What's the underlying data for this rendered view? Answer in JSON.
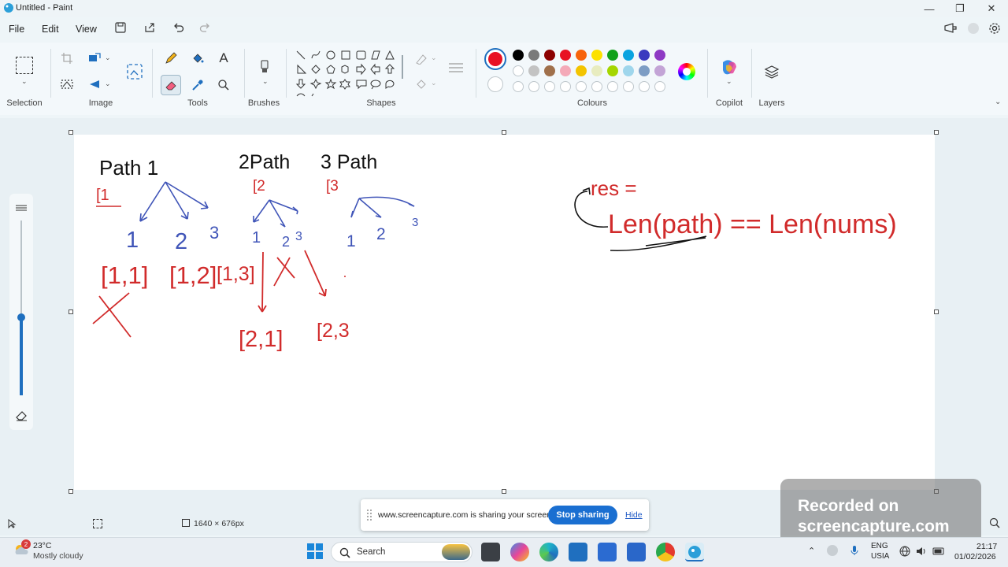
{
  "window": {
    "title": "Untitled - Paint",
    "minimize": "—",
    "restore": "❐",
    "close": "✕"
  },
  "menu": {
    "file": "File",
    "edit": "Edit",
    "view": "View"
  },
  "ribbon": {
    "groups": {
      "selection": "Selection",
      "image": "Image",
      "tools": "Tools",
      "brushes": "Brushes",
      "shapes": "Shapes",
      "colours": "Colours",
      "copilot": "Copilot",
      "layers": "Layers"
    },
    "tools": {
      "text_tool": "A"
    },
    "colours": {
      "primary": "#e81123",
      "secondary": "#ffffff",
      "row1": [
        "#000000",
        "#7a7a7a",
        "#8b0000",
        "#e81123",
        "#f7630c",
        "#fce100",
        "#10a01a",
        "#0aa3e0",
        "#3a3abf",
        "#8e3ac4"
      ],
      "row2": [
        "#ffffff",
        "#c3c3c3",
        "#a0704b",
        "#f4a9b8",
        "#f3c400",
        "#e8ecbf",
        "#a5d600",
        "#9fd6ec",
        "#7d9dc4",
        "#c3a4d6"
      ],
      "row3_empty": 10
    }
  },
  "canvas_labels": {
    "path1": "Path 1",
    "path2": "2Path",
    "path3": "3 Path",
    "br1": "[1",
    "br2": "[2",
    "br3": "[3",
    "n_a1": "1",
    "n_a2": "2",
    "n_a3": "3",
    "n_b1": "1",
    "n_b2": "2",
    "n_b3": "3",
    "n_c1": "1",
    "n_c2": "2",
    "n_c3": "3",
    "pair1": "[1,1]",
    "pair2": "[1,2]",
    "pair3": "[1,3]",
    "pair4": "[2,1]",
    "pair5": "[2,3",
    "res": "res =",
    "len_expr": "Len(path) == Len(nums)"
  },
  "status": {
    "dimensions": "1640 × 676px"
  },
  "sharebar": {
    "message": "www.screencapture.com is sharing your screen.",
    "stop": "Stop sharing",
    "hide": "Hide"
  },
  "watermark": {
    "line1": "Recorded on",
    "line2": "screencapture.com"
  },
  "taskbar": {
    "weather_temp": "23°C",
    "weather_desc": "Mostly cloudy",
    "weather_badge": "2",
    "search": "Search",
    "lang1": "ENG",
    "lang2": "USIA",
    "time": "21:17",
    "date": "01/02/2026"
  }
}
